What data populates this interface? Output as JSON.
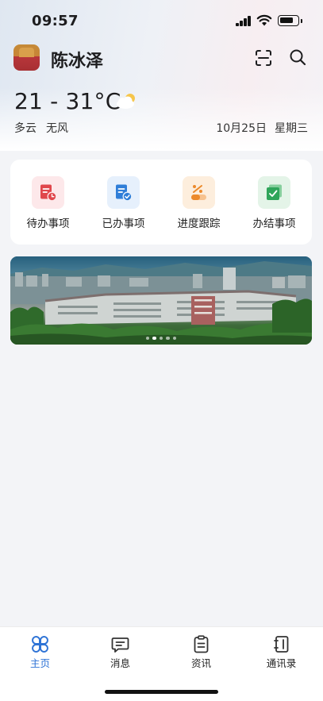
{
  "status_bar": {
    "time": "09:57"
  },
  "header": {
    "user_name": "陈冰泽",
    "icons": {
      "scan": "scan-icon",
      "search": "search-icon"
    }
  },
  "weather": {
    "temperature": "21 - 31°C",
    "condition": "多云",
    "wind": "无风",
    "date": "10月25日",
    "weekday": "星期三",
    "icon": "partly-cloudy-icon"
  },
  "quick_actions": [
    {
      "label": "待办事项",
      "icon": "pending-tasks-icon",
      "color": "#e0474c",
      "bg": "#fde8ea"
    },
    {
      "label": "已办事项",
      "icon": "done-tasks-icon",
      "color": "#2f7ed8",
      "bg": "#e6f0fc"
    },
    {
      "label": "进度跟踪",
      "icon": "progress-tracking-icon",
      "color": "#ec8a2c",
      "bg": "#fdeedd"
    },
    {
      "label": "办结事项",
      "icon": "completed-items-icon",
      "color": "#2fa55a",
      "bg": "#e4f4e8"
    }
  ],
  "banner": {
    "slides": 5,
    "active_index": 1
  },
  "tabbar": {
    "items": [
      {
        "label": "主页",
        "icon": "home-grid-icon",
        "active": true
      },
      {
        "label": "消息",
        "icon": "message-icon",
        "active": false
      },
      {
        "label": "资讯",
        "icon": "news-icon",
        "active": false
      },
      {
        "label": "通讯录",
        "icon": "contacts-icon",
        "active": false
      }
    ],
    "active_color": "#2e73d6"
  }
}
